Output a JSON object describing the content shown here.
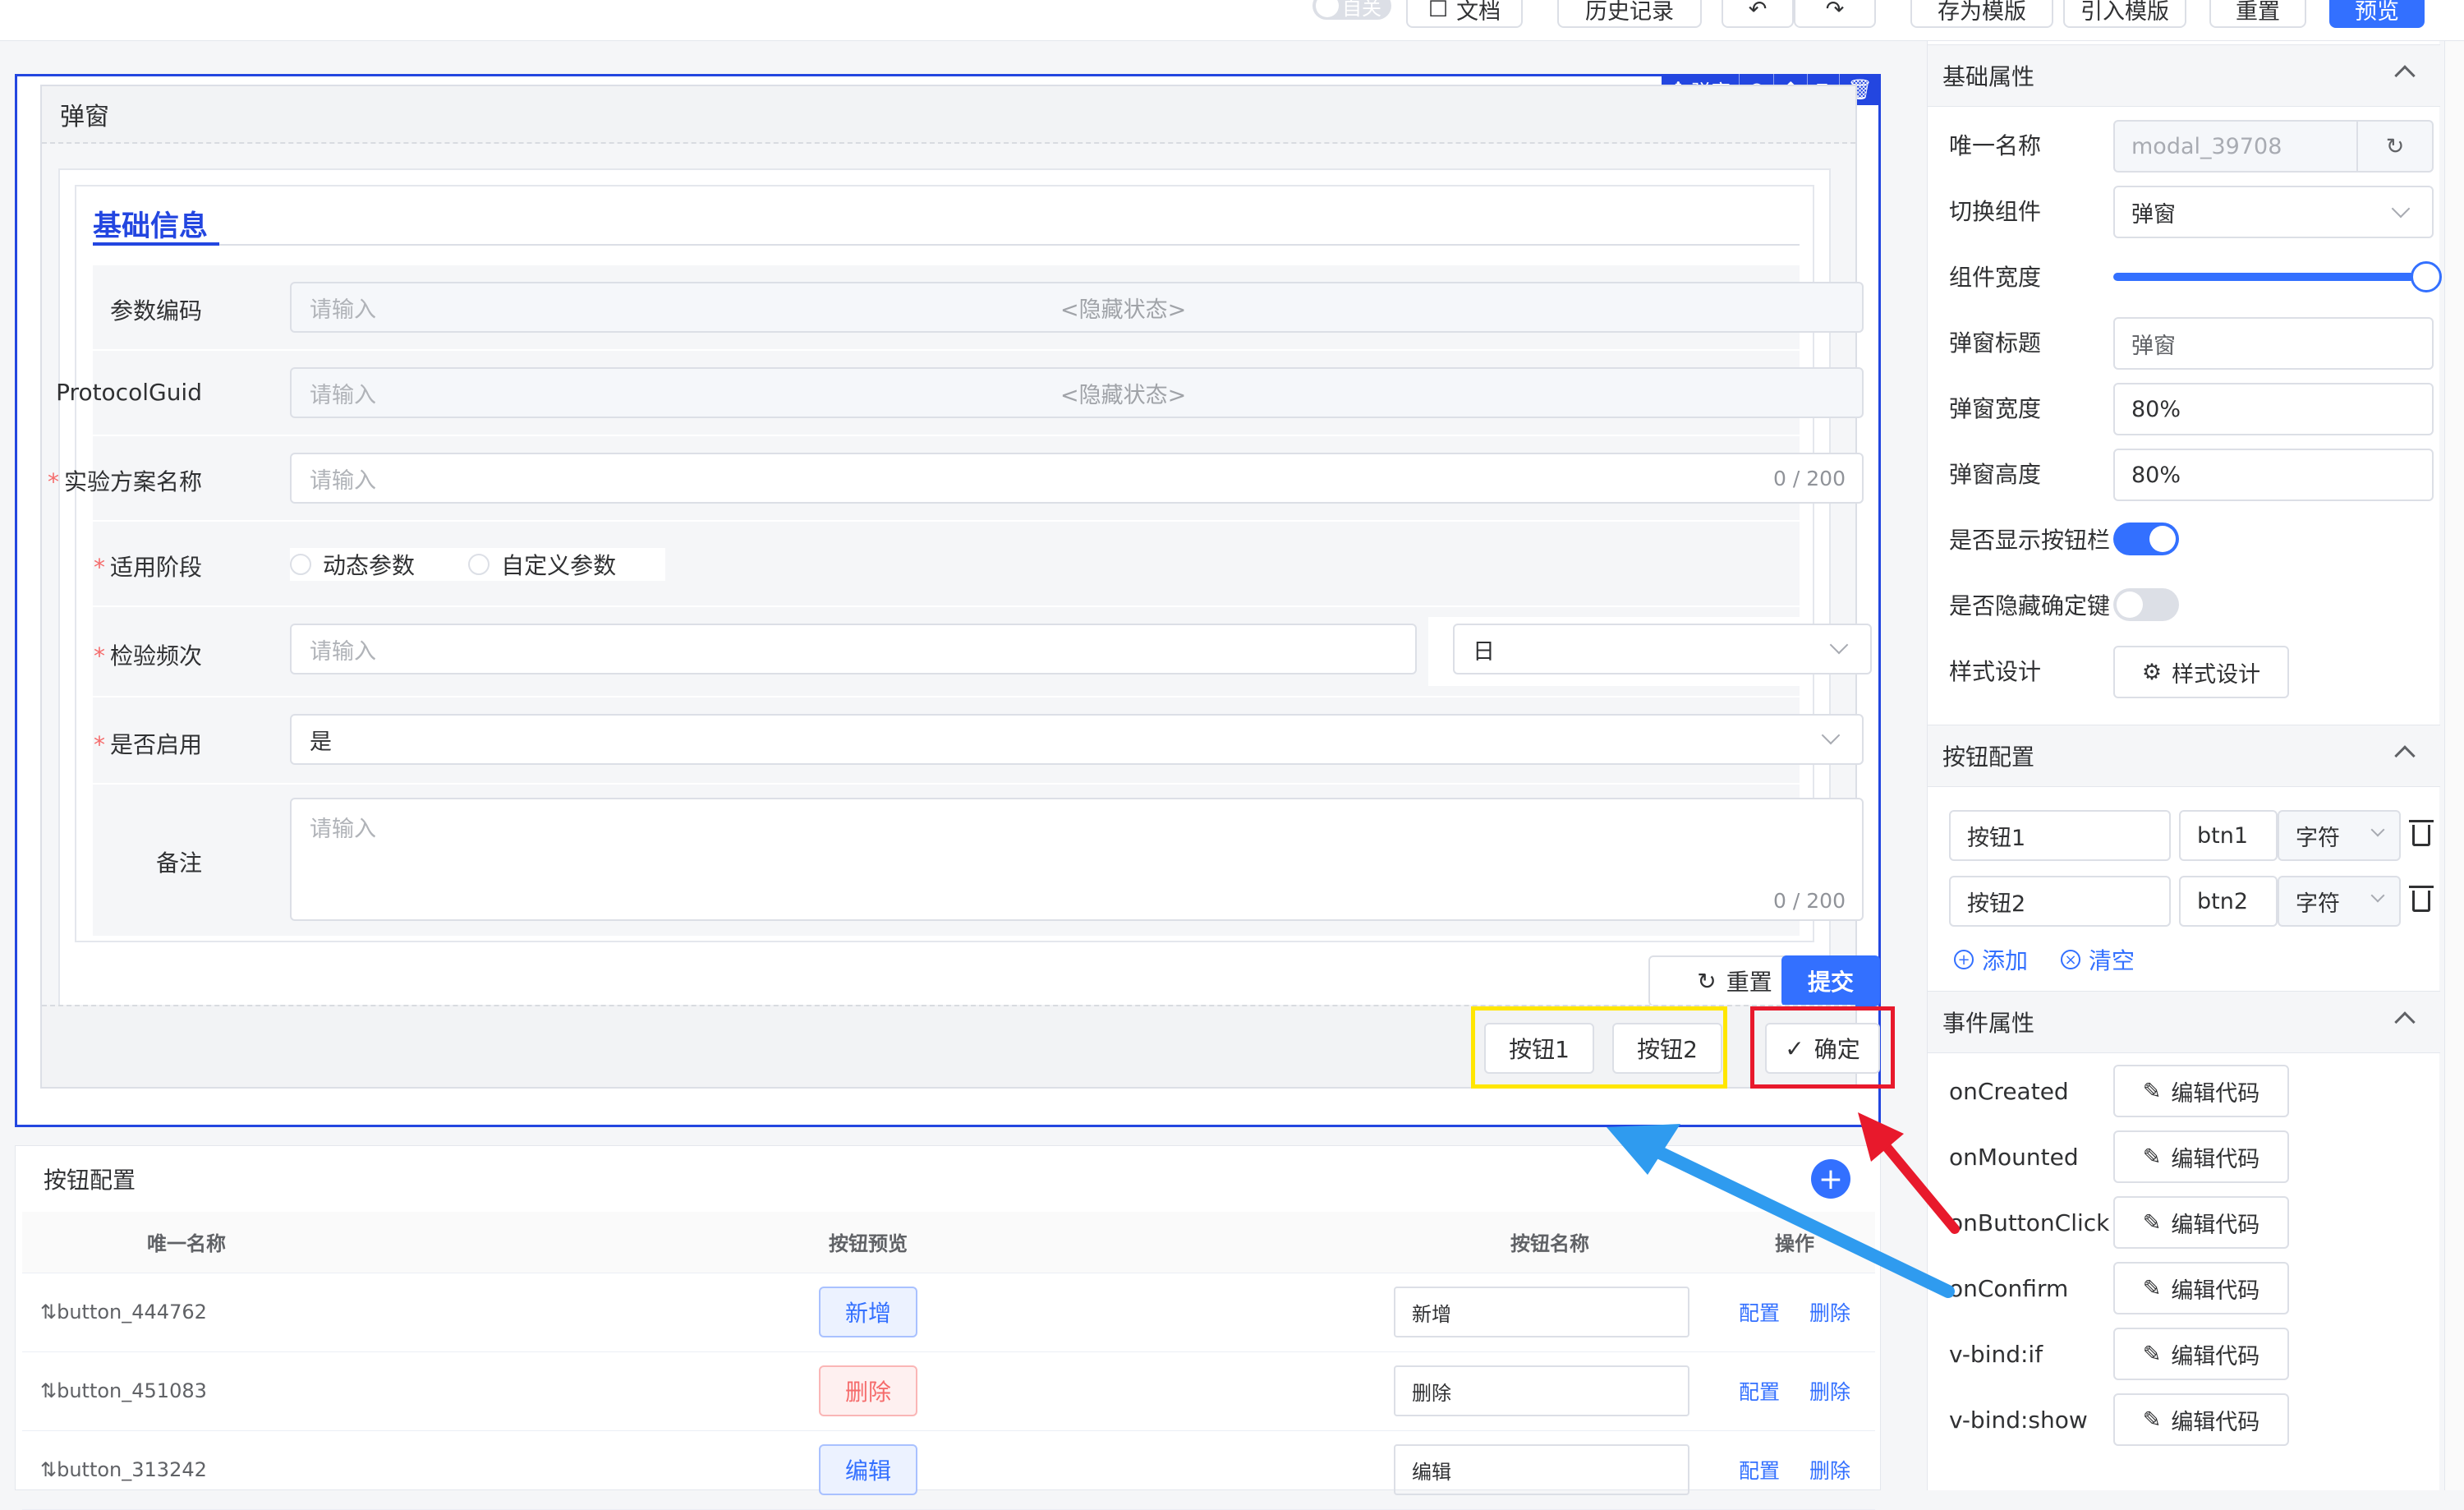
{
  "toolbar": {
    "toggle_text": "自关",
    "doc": "文档",
    "history": "历史记录",
    "undo": "↶",
    "redo": "↷",
    "save_template": "存为模版",
    "import_template": "引入模版",
    "reset": "重置",
    "preview": "预览"
  },
  "selection_toolbar": {
    "label": "弹窗"
  },
  "modal": {
    "title": "弹窗",
    "section_title": "基础信息",
    "fields": [
      {
        "label": "参数编码",
        "placeholder": "请输入",
        "hidden_tag": "<隐藏状态>",
        "required": false
      },
      {
        "label": "ProtocolGuid",
        "placeholder": "请输入",
        "hidden_tag": "<隐藏状态>",
        "required": false
      },
      {
        "label": "实验方案名称",
        "placeholder": "请输入",
        "count": "0 / 200",
        "required": true
      },
      {
        "label": "适用阶段",
        "options": [
          "动态参数",
          "自定义参数"
        ],
        "required": true
      },
      {
        "label": "检验频次",
        "placeholder": "请输入",
        "unit": "日",
        "required": true
      },
      {
        "label": "是否启用",
        "value": "是",
        "required": true
      },
      {
        "label": "备注",
        "placeholder": "请输入",
        "count": "0 / 200",
        "required": false
      }
    ],
    "form_reset": "重置",
    "form_submit": "提交",
    "footer": {
      "btn1": "按钮1",
      "btn2": "按钮2",
      "confirm": "确定"
    }
  },
  "button_config_panel": {
    "title": "按钮配置",
    "columns": [
      "唯一名称",
      "按钮预览",
      "按钮名称",
      "操作"
    ],
    "rows": [
      {
        "id": "button_444762",
        "preview": "新增",
        "name": "新增",
        "config": "配置",
        "delete": "删除",
        "color": "#3370ff"
      },
      {
        "id": "button_451083",
        "preview": "删除",
        "name": "删除",
        "config": "配置",
        "delete": "删除",
        "color": "#f56c6c"
      },
      {
        "id": "button_313242",
        "preview": "编辑",
        "name": "编辑",
        "config": "配置",
        "delete": "删除",
        "color": "#3370ff"
      }
    ]
  },
  "right_panel": {
    "basic": {
      "title": "基础属性",
      "unique_name_label": "唯一名称",
      "unique_name_value": "modal_39708",
      "switch_comp_label": "切换组件",
      "switch_comp_value": "弹窗",
      "width_label": "组件宽度",
      "width_fraction": 1.0,
      "modal_title_label": "弹窗标题",
      "modal_title_value": "弹窗",
      "modal_width_label": "弹窗宽度",
      "modal_width_value": "80%",
      "modal_height_label": "弹窗高度",
      "modal_height_value": "80%",
      "show_btn_bar_label": "是否显示按钮栏",
      "show_btn_bar": true,
      "hide_confirm_label": "是否隐藏确定键",
      "hide_confirm": false,
      "style_label": "样式设计",
      "style_btn": "样式设计"
    },
    "buttons": {
      "title": "按钮配置",
      "items": [
        {
          "label": "按钮1",
          "key": "btn1",
          "type": "字符"
        },
        {
          "label": "按钮2",
          "key": "btn2",
          "type": "字符"
        }
      ],
      "add": "添加",
      "clear": "清空"
    },
    "events": {
      "title": "事件属性",
      "items": [
        {
          "name": "onCreated",
          "btn": "编辑代码"
        },
        {
          "name": "onMounted",
          "btn": "编辑代码"
        },
        {
          "name": "onButtonClick",
          "btn": "编辑代码"
        },
        {
          "name": "onConfirm",
          "btn": "编辑代码"
        },
        {
          "name": "v-bind:if",
          "btn": "编辑代码"
        },
        {
          "name": "v-bind:show",
          "btn": "编辑代码"
        }
      ]
    }
  },
  "colors": {
    "primary": "#3370ff",
    "selection": "#2346e0",
    "highlight_yellow": "#ffe600",
    "highlight_red": "#e8192c",
    "arrow_blue": "#2f9bef"
  }
}
